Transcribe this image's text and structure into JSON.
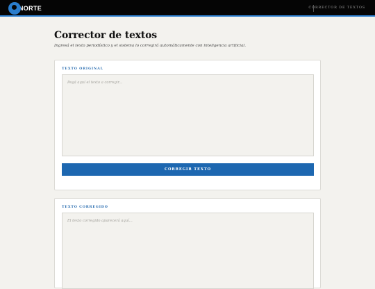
{
  "header": {
    "logo_text": "NORTE",
    "nav_link": "CORRECTOR DE TEXTOS"
  },
  "page": {
    "title": "Corrector de textos",
    "subtitle": "Ingresá el texto periodístico y el sistema lo corregirá automáticamente con inteligencia artificial."
  },
  "original_card": {
    "label": "TEXTO ORIGINAL",
    "placeholder": "Pegá aquí el texto a corregir...",
    "button_label": "CORREGIR TEXTO"
  },
  "corrected_card": {
    "label": "TEXTO CORREGIDO",
    "placeholder": "El texto corregido aparecerá aquí..."
  },
  "colors": {
    "accent": "#1d67b0",
    "label": "#2a6db0",
    "topbar": "#050505",
    "background": "#f3f2ee"
  }
}
